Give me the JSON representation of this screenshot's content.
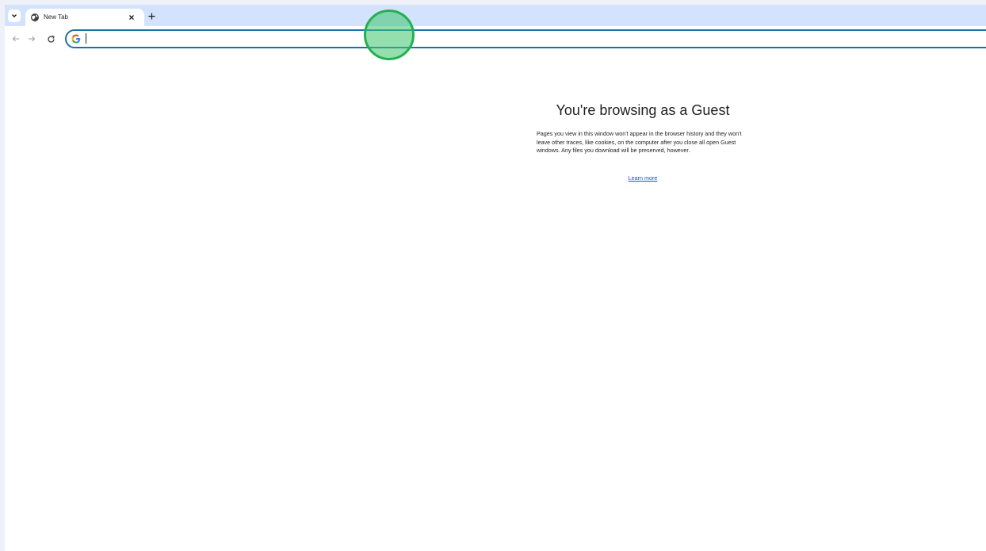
{
  "browser": {
    "tab": {
      "title": "New Tab",
      "favicon": "globe-icon"
    },
    "tabstrip": {
      "search_icon": "chevron-down-icon",
      "close_icon": "close-icon",
      "new_tab_icon": "plus-icon"
    },
    "toolbar": {
      "back_icon": "arrow-left-icon",
      "forward_icon": "arrow-right-icon",
      "reload_icon": "reload-icon",
      "omnibox": {
        "value": "",
        "search_engine_icon": "google-g-icon"
      }
    }
  },
  "page": {
    "title": "You're browsing as a Guest",
    "description": "Pages you view in this window won't appear in the browser history and they won't leave other traces, like cookies, on the computer after you close all open Guest windows. Any files you download will be preserved, however.",
    "learn_more": "Learn more"
  },
  "colors": {
    "tabstrip_bg": "#d3e3fd",
    "omnibox_border": "#1a73a8",
    "link": "#0b57d0",
    "click_indicator": "#23b04e"
  }
}
